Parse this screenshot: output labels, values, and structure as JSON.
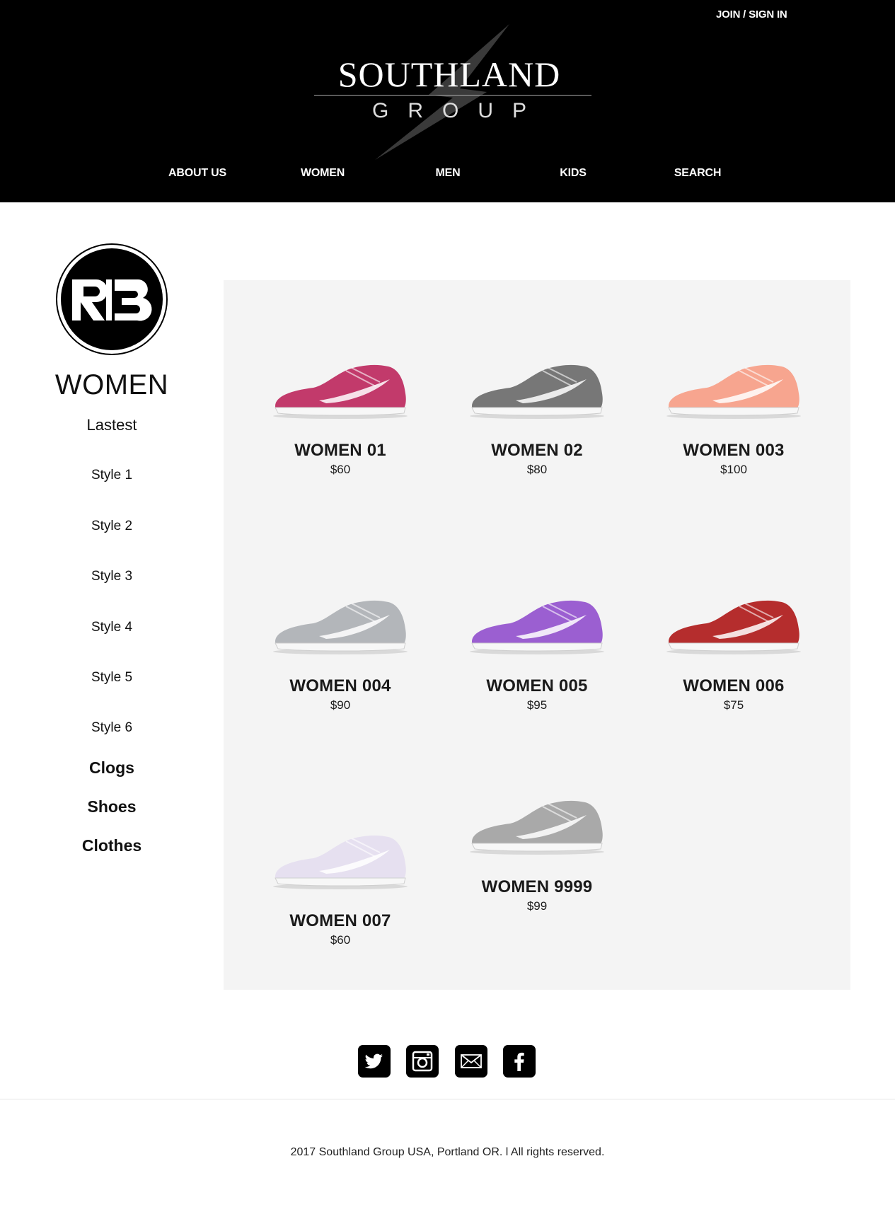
{
  "header": {
    "join_label": "JOIN / SIGN IN",
    "logo_title": "SOUTHLAND",
    "logo_subtitle": "GROUP",
    "nav": [
      {
        "label": "ABOUT US"
      },
      {
        "label": "WOMEN"
      },
      {
        "label": "MEN"
      },
      {
        "label": "KIDS"
      },
      {
        "label": "SEARCH"
      }
    ]
  },
  "sidebar": {
    "category_title": "WOMEN",
    "latest_label": "Lastest",
    "styles": [
      "Style 1",
      "Style 2",
      "Style 3",
      "Style 4",
      "Style 5",
      "Style 6"
    ],
    "groups": [
      "Clogs",
      "Shoes",
      "Clothes"
    ]
  },
  "products": [
    {
      "name": "WOMEN 01",
      "price": "$60",
      "color": "#c23a6b"
    },
    {
      "name": "WOMEN 02",
      "price": "$80",
      "color": "#777777"
    },
    {
      "name": "WOMEN 003",
      "price": "$100",
      "color": "#f7a58f"
    },
    {
      "name": "WOMEN 004",
      "price": "$90",
      "color": "#b3b6ba"
    },
    {
      "name": "WOMEN 005",
      "price": "$95",
      "color": "#9b5fd1"
    },
    {
      "name": "WOMEN 006",
      "price": "$75",
      "color": "#b52d2d"
    },
    {
      "name": "WOMEN 007",
      "price": "$60",
      "color": "#e6e0f0"
    },
    {
      "name": "WOMEN 9999",
      "price": "$99",
      "color": "#a9a9a9"
    }
  ],
  "social": [
    "twitter-icon",
    "instagram-icon",
    "mail-icon",
    "facebook-icon"
  ],
  "footer": {
    "copyright": "2017 Southland Group USA, Portland OR. l All rights reserved."
  }
}
